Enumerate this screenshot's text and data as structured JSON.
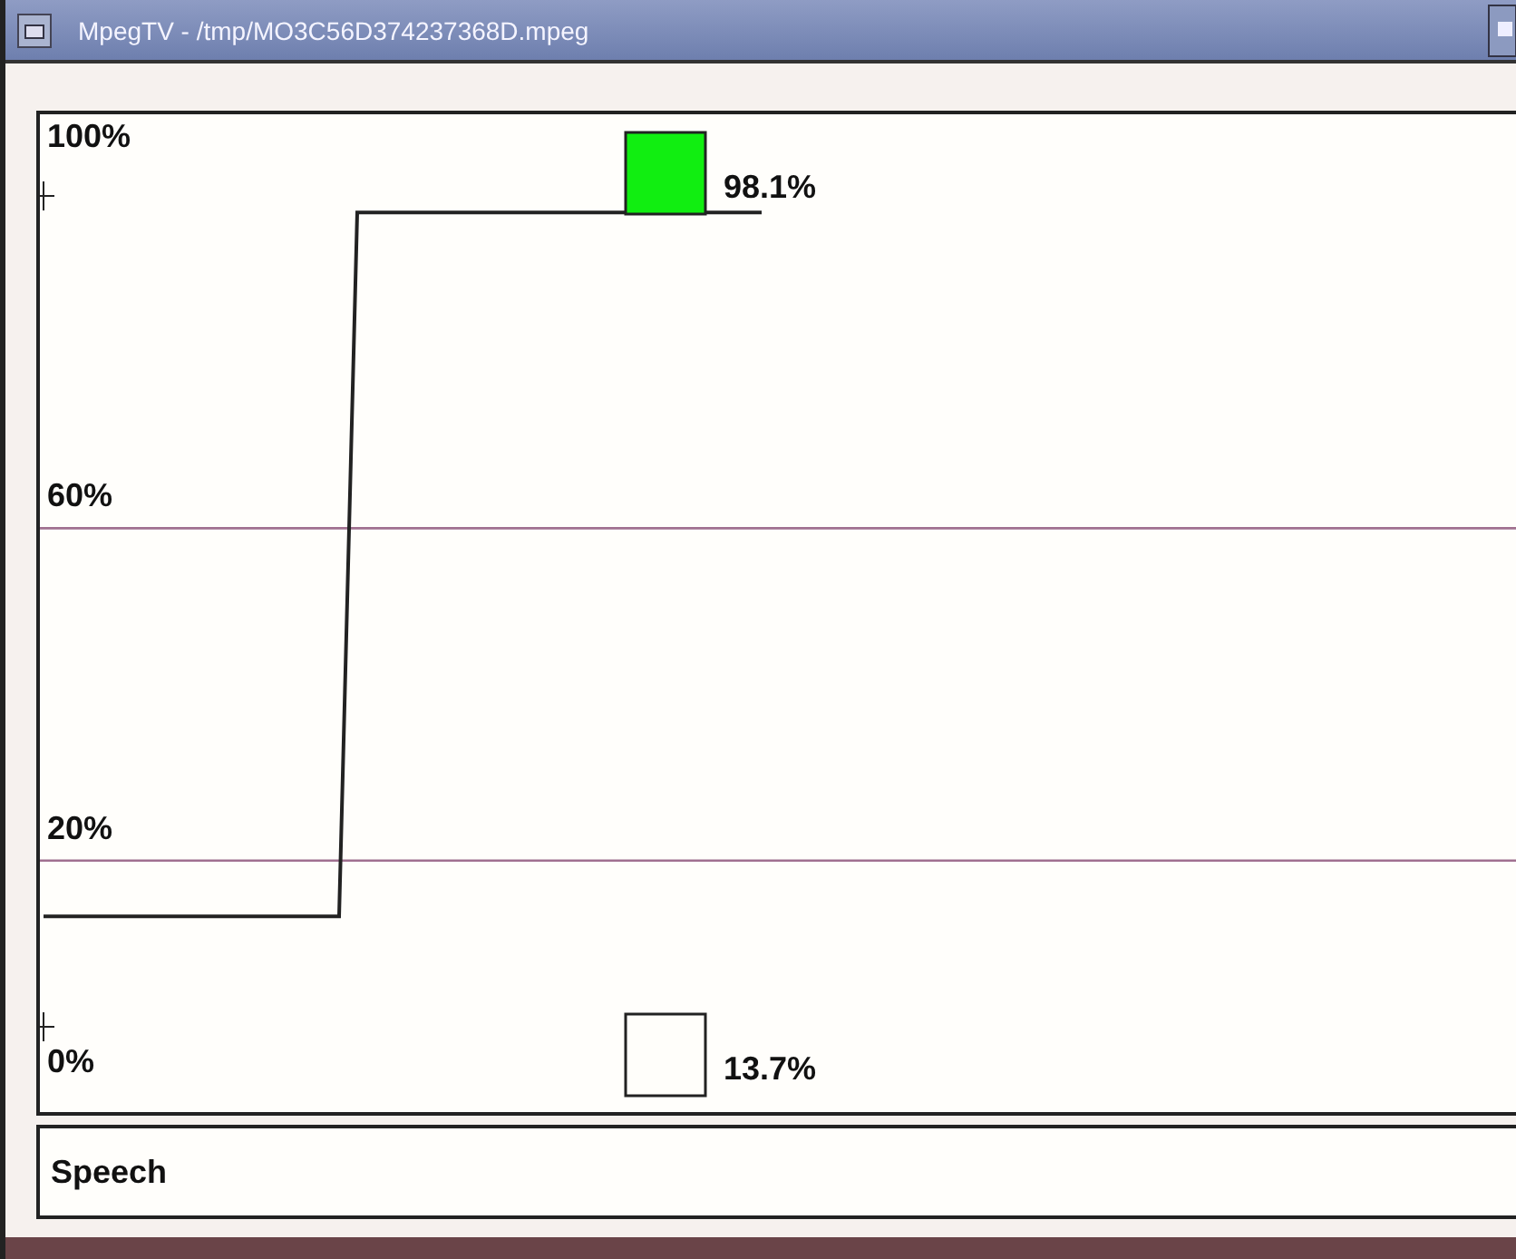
{
  "window": {
    "title": "MpegTV - /tmp/MO3C56D374237368D.mpeg"
  },
  "chart": {
    "scale_labels": [
      "100%",
      "60%",
      "20%",
      "0%"
    ]
  },
  "indicators": [
    {
      "reading": "98.1%",
      "on": true
    },
    {
      "reading": "13.7%",
      "on": false
    }
  ],
  "label": "Speech"
}
